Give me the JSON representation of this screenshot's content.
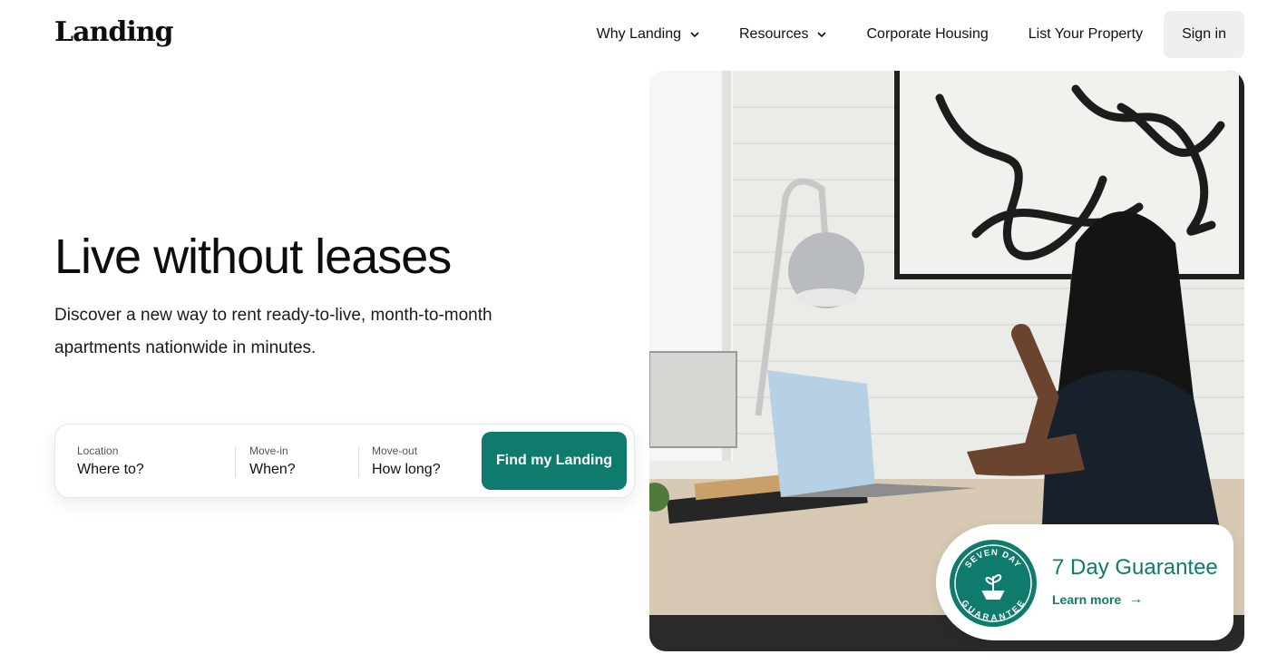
{
  "brand": {
    "logo": "Landing",
    "accent": "#0f7b6c"
  },
  "nav": {
    "why_landing": "Why Landing",
    "resources": "Resources",
    "corporate_housing": "Corporate Housing",
    "list_property": "List Your Property",
    "sign_in": "Sign in"
  },
  "hero": {
    "title": "Live without leases",
    "subtitle": "Discover a new way to rent ready-to-live, month-to-month apartments nationwide in minutes."
  },
  "search": {
    "location": {
      "label": "Location",
      "value": "Where to?"
    },
    "move_in": {
      "label": "Move-in",
      "value": "When?"
    },
    "move_out": {
      "label": "Move-out",
      "value": "How long?"
    },
    "button": "Find my Landing"
  },
  "guarantee": {
    "seal_top": "SEVEN DAY",
    "seal_bottom": "GUARANTEE",
    "title": "7 Day Guarantee",
    "link": "Learn more",
    "arrow": "→"
  }
}
